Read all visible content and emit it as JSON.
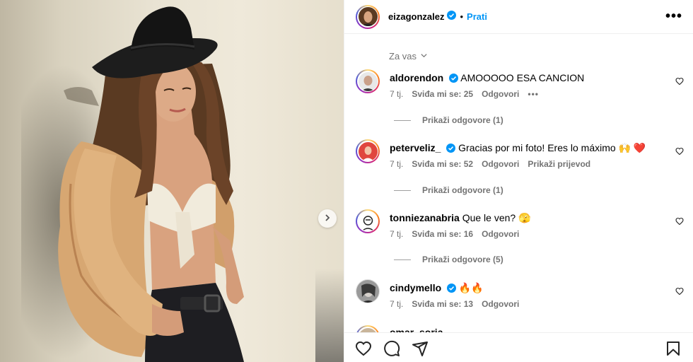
{
  "post": {
    "author": "eizagonzalez",
    "follow_label": "Prati",
    "dot": "•",
    "more_label": "•••"
  },
  "filter": {
    "label": "Za vas"
  },
  "comments": [
    {
      "user": "aldorendon",
      "verified": true,
      "text": "AMOOOOO ESA CANCION",
      "time": "7 tj.",
      "likes": "Sviđa mi se: 25",
      "reply": "Odgovori",
      "extra": "•••",
      "replies_label": "Prikaži odgovore (1)"
    },
    {
      "user": "peterveliz_",
      "verified": true,
      "text": "Gracias por mi foto! Eres lo máximo 🙌 ❤️",
      "time": "7 tj.",
      "likes": "Sviđa mi se: 52",
      "reply": "Odgovori",
      "extra": "Prikaži prijevod",
      "replies_label": "Prikaži odgovore (1)"
    },
    {
      "user": "tonniezanabria",
      "verified": false,
      "text": "Que le ven? 🫣",
      "time": "7 tj.",
      "likes": "Sviđa mi se: 16",
      "reply": "Odgovori",
      "replies_label": "Prikaži odgovore (5)"
    },
    {
      "user": "cindymello",
      "verified": true,
      "text": "🔥🔥",
      "time": "7 tj.",
      "likes": "Sviđa mi se: 13",
      "reply": "Odgovori"
    }
  ],
  "partial_comment": {
    "user": "omar_soria"
  },
  "colors": {
    "link": "#0095f6",
    "verified": "#0095f6",
    "muted": "#737373"
  },
  "icons": [
    "heart-icon",
    "comment-icon",
    "share-icon",
    "bookmark-icon",
    "chevron-right-icon",
    "verified-badge-icon",
    "chevron-down-icon",
    "more-icon"
  ]
}
